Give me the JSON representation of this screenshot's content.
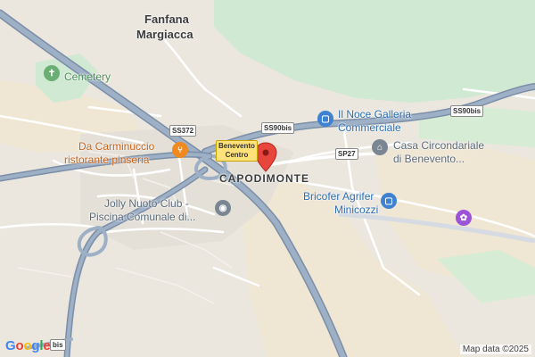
{
  "map": {
    "places": {
      "fanfana": "Fanfana",
      "margiacca": "Margiacca",
      "capodimonte": "CAPODIMONTE"
    },
    "pois": {
      "cemetery": "Cemetery",
      "il_noce_line1": "Il Noce Galleria",
      "il_noce_line2": "Commerciale",
      "da_carminuccio_line1": "Da Carminuccio",
      "da_carminuccio_line2": "ristorante pinseria",
      "casa_line1": "Casa Circondariale",
      "casa_line2": "di Benevento...",
      "bricofer_line1": "Bricofer Agrifer",
      "bricofer_line2": "Minicozzi",
      "jolly_line1": "Jolly Nuoto Club -",
      "jolly_line2": "Piscina Comunale di..."
    },
    "road_shields": {
      "ss372": "SS372",
      "ss90bis_center": "SS90bis",
      "ss90bis_right": "SS90bis",
      "sp27": "SP27",
      "ss90bis_bottom": "bis",
      "benevento_line1": "Benevento",
      "benevento_line2": "Centro"
    },
    "icons": {
      "cemetery": "cemetery-icon",
      "il_noce": "shopping-bag-icon",
      "restaurant": "fork-knife-icon",
      "casa": "landmark-icon",
      "bricofer": "shopping-bag-icon",
      "jolly": "swimming-pool-icon",
      "purple_poi": "entertainment-icon",
      "location_pin": "location-pin-icon"
    },
    "colors": {
      "highway": "#8fa4bd",
      "highway_casing": "#7b8ea8",
      "road": "#ffffff",
      "land": "#ebe7df",
      "sand": "#efe6d3",
      "green_area": "#cfe9d2",
      "pin": "#e8453c"
    }
  },
  "branding": {
    "logo": "Google"
  },
  "attribution": "Map data ©2025"
}
